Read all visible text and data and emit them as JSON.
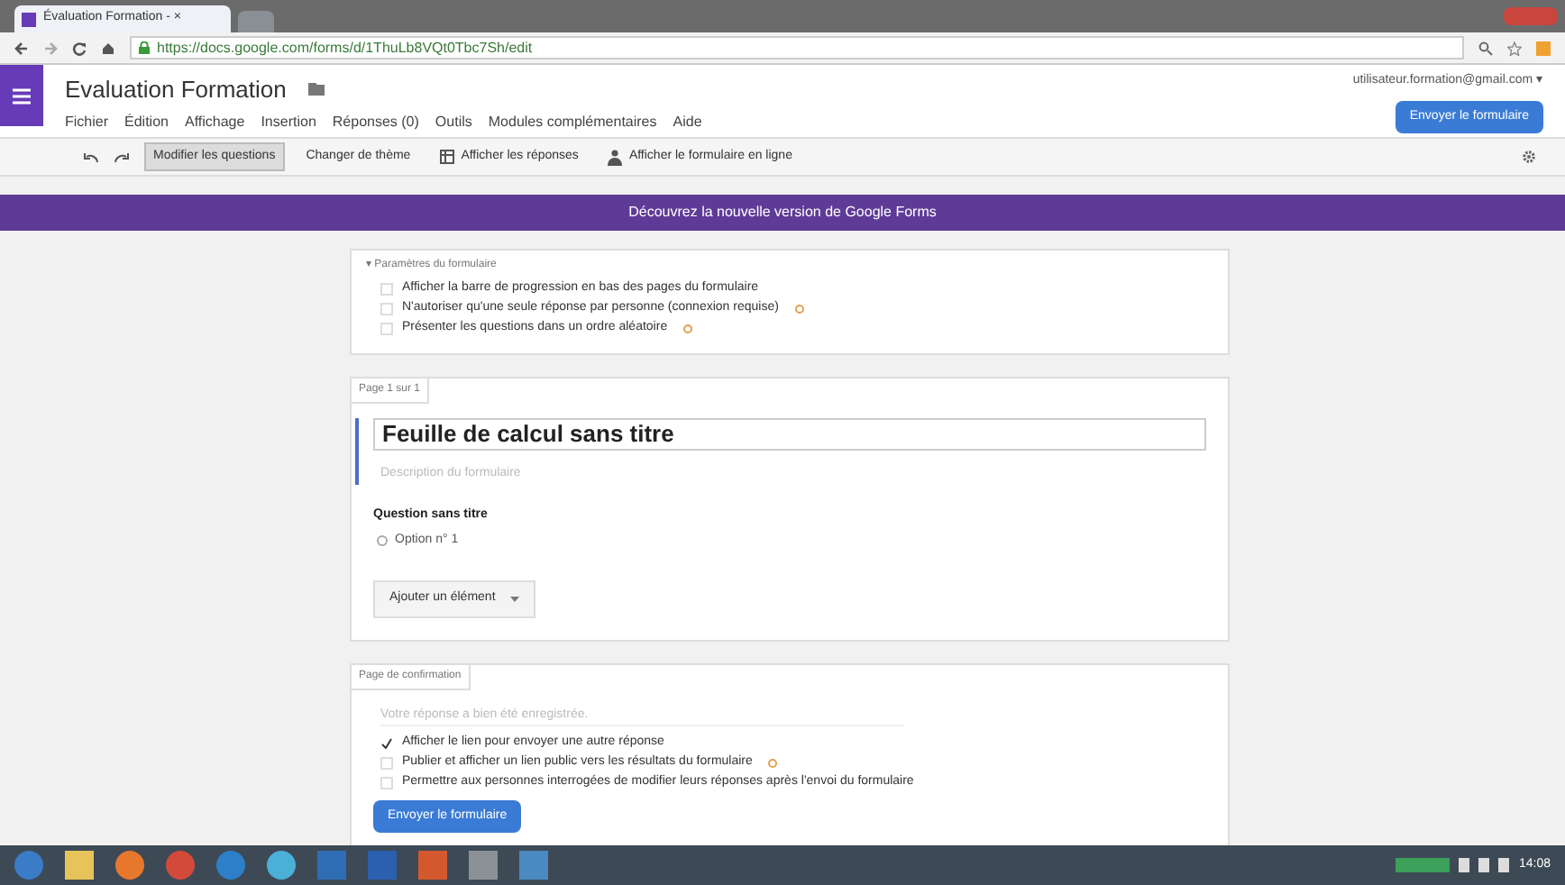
{
  "browser": {
    "tab_title": "Évaluation Formation - ×",
    "url": "https://docs.google.com/forms/d/1ThuLb8VQt0Tbc7Sh/edit"
  },
  "header": {
    "title": "Evaluation Formation",
    "account": "utilisateur.formation@gmail.com ▾",
    "send_button": "Envoyer le formulaire"
  },
  "menu": [
    "Fichier",
    "Édition",
    "Affichage",
    "Insertion",
    "Réponses (0)",
    "Outils",
    "Modules complémentaires",
    "Aide"
  ],
  "toolbar": [
    {
      "label": "Modifier les questions",
      "selected": true,
      "kind": "tab"
    },
    {
      "label": "Changer de thème",
      "selected": false,
      "kind": "tab"
    },
    {
      "label": "Afficher les réponses",
      "selected": false,
      "kind": "responses"
    },
    {
      "label": "Afficher le formulaire en ligne",
      "selected": false,
      "kind": "live"
    }
  ],
  "banner": "Découvrez la nouvelle version de Google Forms",
  "settings": {
    "title": "▾ Paramètres du formulaire",
    "options": [
      {
        "label": "Afficher la barre de progression en bas des pages du formulaire",
        "checked": false,
        "help": false
      },
      {
        "label": "N'autoriser qu'une seule réponse par personne (connexion requise)",
        "checked": false,
        "help": true
      },
      {
        "label": "Présenter les questions dans un ordre aléatoire",
        "checked": false,
        "help": true
      }
    ]
  },
  "page": {
    "label": "Page 1 sur 1",
    "title": "Feuille de calcul sans titre",
    "description_placeholder": "Description du formulaire",
    "question": "Question sans titre",
    "option": "Option n° 1",
    "option_selected": false,
    "add_button": "Ajouter un élément"
  },
  "confirmation": {
    "label": "Page de confirmation",
    "placeholder": "Votre réponse a bien été enregistrée.",
    "options": [
      {
        "label": "Afficher le lien pour envoyer une autre réponse",
        "checked": true,
        "help": false
      },
      {
        "label": "Publier et afficher un lien public vers les résultats du formulaire",
        "checked": false,
        "help": true
      },
      {
        "label": "Permettre aux personnes interrogées de modifier leurs réponses après l'envoi du formulaire",
        "checked": false,
        "help": false
      }
    ],
    "send_button": "Envoyer le formulaire"
  },
  "taskbar": {
    "clock": "14:08"
  }
}
